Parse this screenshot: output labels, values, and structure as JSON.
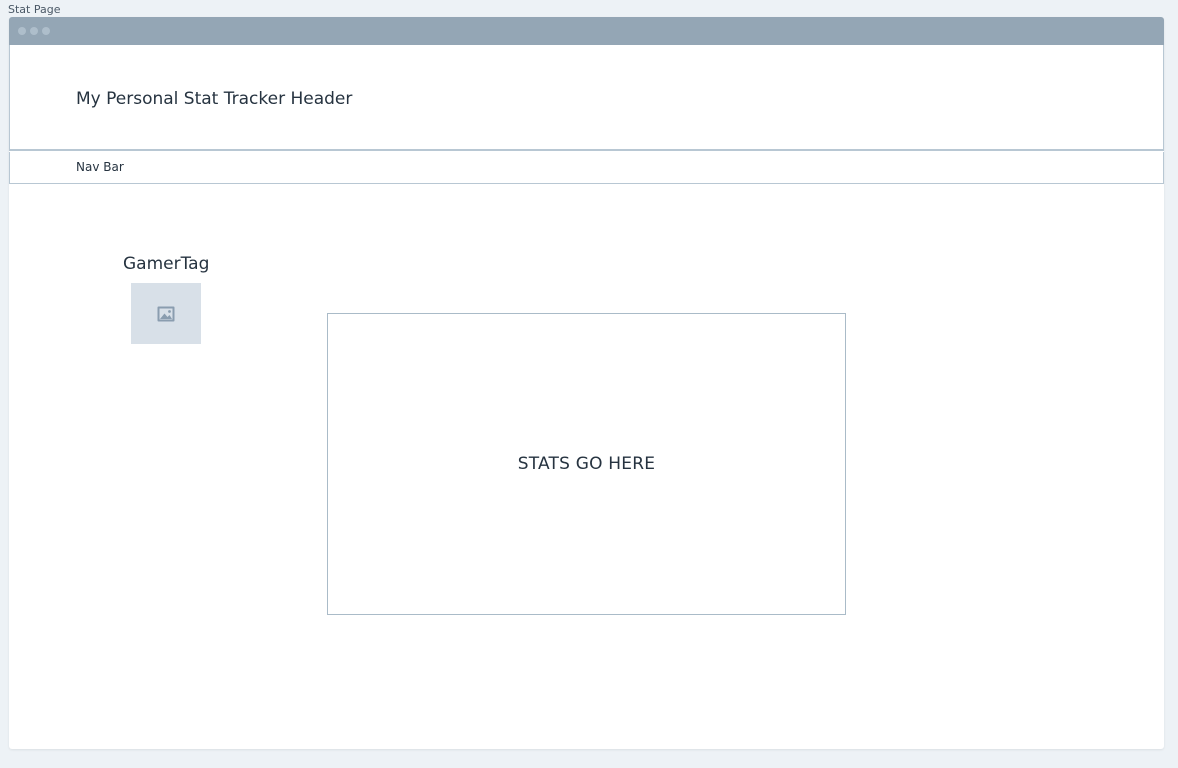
{
  "page": {
    "label": "Stat Page"
  },
  "header": {
    "title": "My Personal Stat Tracker Header"
  },
  "nav": {
    "label": "Nav Bar"
  },
  "profile": {
    "gamertag": "GamerTag",
    "avatar_icon": "image-placeholder-icon"
  },
  "main": {
    "stats_placeholder": "STATS GO HERE"
  },
  "colors": {
    "titlebar": "#94a6b5",
    "border": "#b8c7d3",
    "avatar_bg": "#d8e0e8",
    "background": "#edf2f6"
  }
}
